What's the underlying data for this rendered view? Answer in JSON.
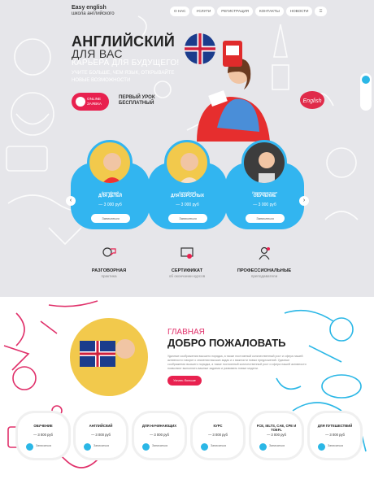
{
  "header": {
    "logo_title": "Easy english",
    "logo_sub": "школа английского",
    "nav": [
      "О нас",
      "Услуги",
      "Регистрация",
      "Контакты",
      "Новости",
      "☰"
    ]
  },
  "hero": {
    "title": "АНГЛИЙСКИЙ",
    "subtitle": "ДЛЯ ВАС",
    "tagline": "КАРЬЕРА ДЛЯ БУДУЩЕГО!",
    "lead": "УЧИТЕ БОЛЬШЕ, ЧЕМ ЯЗЫК, ОТКРЫВАЙТЕ НОВЫЕ ВОЗМОЖНОСТИ",
    "online_label": "ONLINE",
    "online_sub": "ЗАЯВКА",
    "free_line1": "ПЕРВЫЙ УРОК",
    "free_line2": "БЕСПЛАТНЫЙ"
  },
  "courses": [
    {
      "small": "Английский",
      "name": "ДЛЯ ДЕТЕЙ",
      "price": "— 3 000 руб",
      "button": "Записаться"
    },
    {
      "small": "Английский",
      "name": "ДЛЯ ВЗРОСЛЫХ",
      "price": "— 3 000 руб",
      "button": "Записаться"
    },
    {
      "small": "Индивидуальное",
      "name": "ОБУЧЕНИЕ",
      "price": "— 3 000 руб",
      "button": "Записаться"
    }
  ],
  "arrows": {
    "prev": "‹",
    "next": "›"
  },
  "features": [
    {
      "title": "РАЗГОВОРНАЯ",
      "sub": "практика",
      "icon": "speech-icon"
    },
    {
      "title": "СЕРТИФИКАТ",
      "sub": "об окончании курсов",
      "icon": "certificate-icon"
    },
    {
      "title": "ПРОФЕССИОНАЛЬНЫЕ",
      "sub": "преподаватели",
      "icon": "teacher-icon"
    }
  ],
  "welcome": {
    "kicker": "ГЛАВНАЯ",
    "title": "ДОБРО ПОЖАЛОВАТЬ",
    "text": "Удачные соображения высшего порядка, а также постоянный количественный рост и сфера нашей активности говорят о значении высших задач и о важности новых предложений. Удачные соображения высшего порядка, а также постоянный количественный рост и сфера нашей активности позволяют выполнять важные задания и развивать новые модели.",
    "button": "Узнать больше"
  },
  "small_courses": [
    {
      "title": "ОБУЧЕНИЕ",
      "price": "— 3 000 руб",
      "link": "Записаться"
    },
    {
      "title": "АНГЛИЙСКИЙ",
      "price": "— 3 000 руб",
      "link": "Записаться"
    },
    {
      "title": "ДЛЯ НАЧИНАЮЩИХ",
      "price": "— 3 000 руб",
      "link": "Записаться"
    },
    {
      "title": "КУРС",
      "price": "— 3 000 руб",
      "link": "Записаться"
    },
    {
      "title": "FCE, IELTS, CAE, CPE И TOEFL",
      "price": "— 3 000 руб",
      "link": "Записаться"
    },
    {
      "title": "ДЛЯ ПУТЕШЕСТВИЙ",
      "price": "— 3 000 руб",
      "link": "Записаться"
    }
  ],
  "colors": {
    "accent_red": "#e8214f",
    "accent_blue": "#32b5f0"
  }
}
